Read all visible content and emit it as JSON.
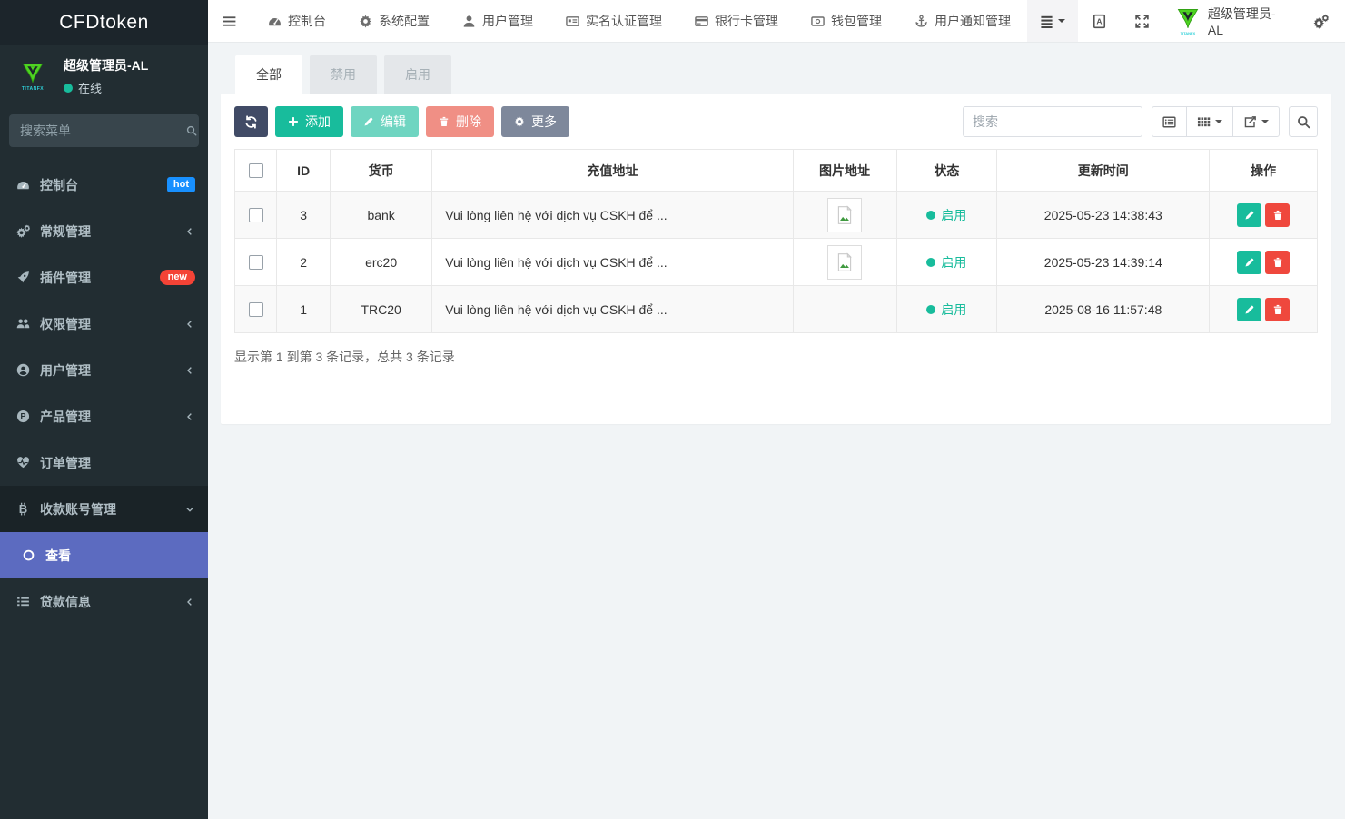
{
  "brand": {
    "title": "CFDtoken",
    "logo_text": "TITANFX"
  },
  "user_panel": {
    "name": "超级管理员-AL",
    "status": "在线"
  },
  "colors": {
    "success": "#18bc9c",
    "danger": "#e74c3c",
    "active_item": "#5c6bc0",
    "badge_hot": "#1890ff",
    "badge_new": "#f44336"
  },
  "sidebar": {
    "search_placeholder": "搜索菜单",
    "items": [
      {
        "label": "控制台",
        "icon": "gauge-icon",
        "badge": "hot",
        "badge_color": "#1890ff",
        "badge_pill": false
      },
      {
        "label": "常规管理",
        "icon": "gears-icon",
        "chevron": "left"
      },
      {
        "label": "插件管理",
        "icon": "rocket-icon",
        "badge": "new",
        "badge_color": "#f44336",
        "badge_pill": true
      },
      {
        "label": "权限管理",
        "icon": "users-icon",
        "chevron": "left"
      },
      {
        "label": "用户管理",
        "icon": "user-circle-icon",
        "chevron": "left"
      },
      {
        "label": "产品管理",
        "icon": "product-circle-icon",
        "chevron": "left"
      },
      {
        "label": "订单管理",
        "icon": "heartbeat-icon"
      },
      {
        "label": "收款账号管理",
        "icon": "bitcoin-icon",
        "chevron": "down",
        "expanded": true
      },
      {
        "label": "查看",
        "icon": "circle-o-icon",
        "active": true,
        "child": true
      },
      {
        "label": "贷款信息",
        "icon": "list-icon",
        "chevron": "left"
      }
    ]
  },
  "topnav": {
    "items": [
      {
        "label": "控制台",
        "icon": "gauge-icon"
      },
      {
        "label": "系统配置",
        "icon": "gear-icon"
      },
      {
        "label": "用户管理",
        "icon": "user-icon"
      },
      {
        "label": "实名认证管理",
        "icon": "id-card-icon"
      },
      {
        "label": "银行卡管理",
        "icon": "credit-card-icon"
      },
      {
        "label": "钱包管理",
        "icon": "wallet-icon"
      },
      {
        "label": "用户通知管理",
        "icon": "anchor-icon"
      }
    ],
    "user_name": "超级管理员-AL"
  },
  "tabs": [
    {
      "label": "全部",
      "active": true
    },
    {
      "label": "禁用",
      "active": false
    },
    {
      "label": "启用",
      "active": false
    }
  ],
  "toolbar": {
    "add_label": "添加",
    "edit_label": "编辑",
    "delete_label": "删除",
    "more_label": "更多",
    "search_placeholder": "搜索"
  },
  "table": {
    "columns": [
      "ID",
      "货币",
      "充值地址",
      "图片地址",
      "状态",
      "更新时间",
      "操作"
    ],
    "rows": [
      {
        "id": "3",
        "currency": "bank",
        "address": "Vui lòng liên hệ với dịch vụ CSKH để ...",
        "has_image": true,
        "status": "启用",
        "updated": "2025-05-23 14:38:43"
      },
      {
        "id": "2",
        "currency": "erc20",
        "address": "Vui lòng liên hệ với dịch vụ CSKH để ...",
        "has_image": true,
        "status": "启用",
        "updated": "2025-05-23 14:39:14"
      },
      {
        "id": "1",
        "currency": "TRC20",
        "address": "Vui lòng liên hệ với dịch vụ CSKH để ...",
        "has_image": false,
        "status": "启用",
        "updated": "2025-08-16 11:57:48"
      }
    ]
  },
  "footer": {
    "summary": "显示第 1 到第 3 条记录，总共 3 条记录"
  }
}
